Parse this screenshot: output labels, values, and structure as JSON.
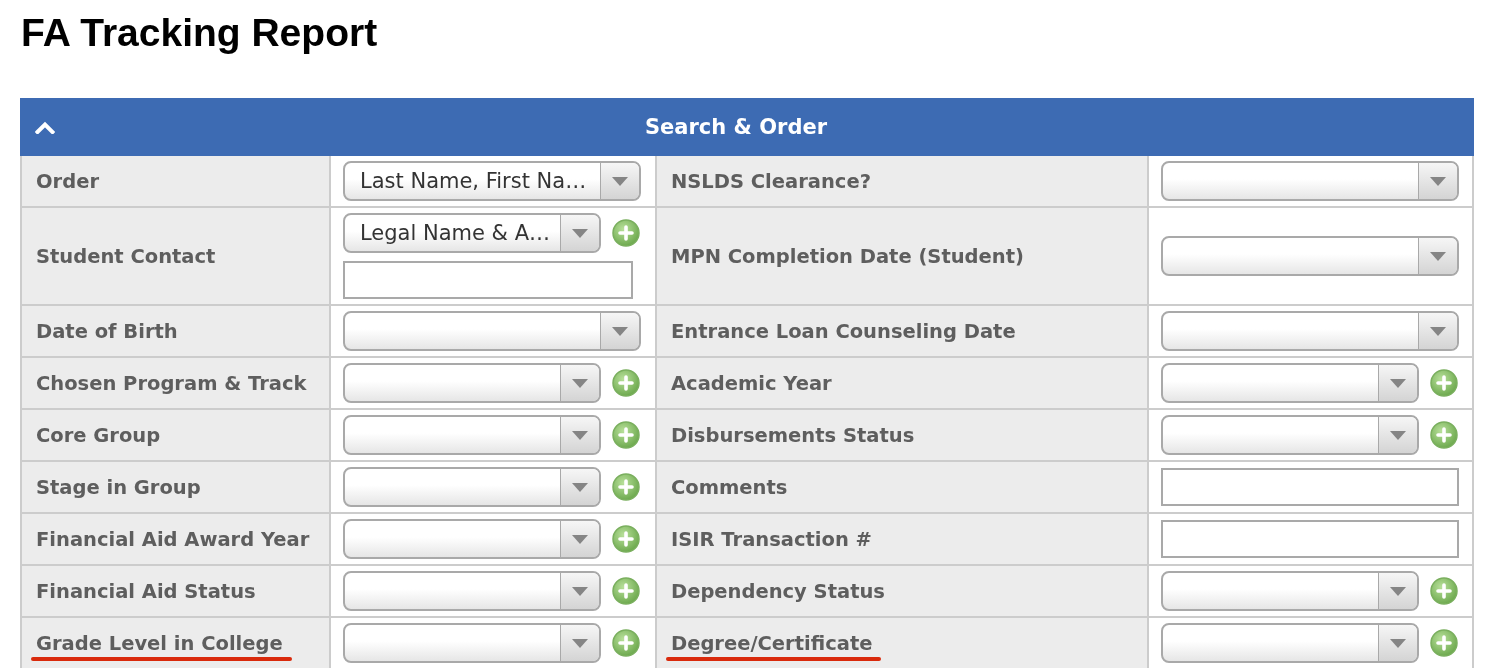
{
  "page": {
    "title": "FA Tracking Report"
  },
  "panel": {
    "title": "Search & Order",
    "expanded": true
  },
  "rows": [
    {
      "cells": [
        {
          "label": "Order",
          "kind": "select",
          "value": "Last Name, First Na…",
          "add_button": false,
          "underlined": false
        },
        {
          "label": "NSLDS Clearance?",
          "kind": "select",
          "add_button": false,
          "underlined": false
        }
      ]
    },
    {
      "cells": [
        {
          "label": "Student Contact",
          "kind": "select_text",
          "value": "Legal Name & A…",
          "add_button": true,
          "underlined": false
        },
        {
          "label": "MPN Completion Date (Student)",
          "kind": "select",
          "add_button": false,
          "underlined": false
        }
      ]
    },
    {
      "cells": [
        {
          "label": "Date of Birth",
          "kind": "select",
          "add_button": false,
          "underlined": false
        },
        {
          "label": "Entrance Loan Counseling Date",
          "kind": "select",
          "add_button": false,
          "underlined": false
        }
      ]
    },
    {
      "cells": [
        {
          "label": "Chosen Program & Track",
          "kind": "select",
          "add_button": true,
          "underlined": false
        },
        {
          "label": "Academic Year",
          "kind": "select",
          "add_button": true,
          "underlined": false
        }
      ]
    },
    {
      "cells": [
        {
          "label": "Core Group",
          "kind": "select",
          "add_button": true,
          "underlined": false
        },
        {
          "label": "Disbursements Status",
          "kind": "select",
          "add_button": true,
          "underlined": false
        }
      ]
    },
    {
      "cells": [
        {
          "label": "Stage in Group",
          "kind": "select",
          "add_button": true,
          "underlined": false
        },
        {
          "label": "Comments",
          "kind": "text",
          "add_button": false,
          "underlined": false
        }
      ]
    },
    {
      "cells": [
        {
          "label": "Financial Aid Award Year",
          "kind": "select",
          "add_button": true,
          "underlined": false
        },
        {
          "label": "ISIR Transaction #",
          "kind": "text",
          "add_button": false,
          "underlined": false
        }
      ]
    },
    {
      "cells": [
        {
          "label": "Financial Aid Status",
          "kind": "select",
          "add_button": true,
          "underlined": false
        },
        {
          "label": "Dependency Status",
          "kind": "select",
          "add_button": true,
          "underlined": false
        }
      ]
    },
    {
      "cells": [
        {
          "label": "Grade Level in College",
          "kind": "select",
          "add_button": true,
          "underlined": true
        },
        {
          "label": "Degree/Certificate",
          "kind": "select",
          "add_button": true,
          "underlined": true
        }
      ]
    }
  ]
}
